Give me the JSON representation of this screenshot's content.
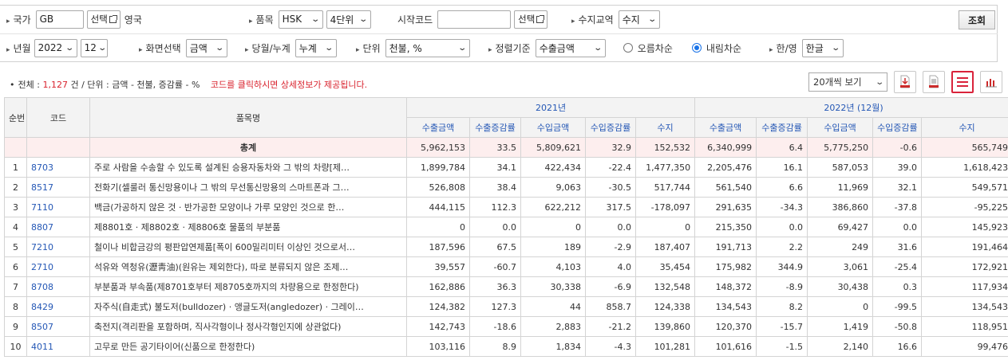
{
  "filters": {
    "country": {
      "label": "국가",
      "value": "GB",
      "select_button": "선택",
      "country_name": "영국"
    },
    "item": {
      "label": "품목",
      "scheme": "HSK",
      "digits": "4단위"
    },
    "start_code": {
      "label": "시작코드",
      "value": "",
      "select_button": "선택"
    },
    "trade_type": {
      "label": "수지교역",
      "value": "수지"
    },
    "search_button": "조회",
    "year_month": {
      "label": "년월",
      "year": "2022",
      "month": "12"
    },
    "screen": {
      "label": "화면선택",
      "value": "금액"
    },
    "period": {
      "label": "당월/누계",
      "value": "누계"
    },
    "unit": {
      "label": "단위",
      "value": "천불, %"
    },
    "sort": {
      "label": "정렬기준",
      "value": "수출금액",
      "asc_label": "오름차순",
      "desc_label": "내림차순",
      "selected": "desc"
    },
    "lang": {
      "label": "한/영",
      "value": "한글"
    }
  },
  "summary": {
    "total_label": "전체 :",
    "count": "1,127",
    "count_suffix": "건 / 단위 : 금액 - 천불, 증감률 - %",
    "notice": "코드를 클릭하시면 상세정보가 제공됩니다."
  },
  "toolbar": {
    "page_size": "20개씩 보기",
    "icons": [
      "download-red-icon",
      "print-doc-icon",
      "list-view-icon",
      "bar-chart-icon"
    ]
  },
  "colors": {
    "accent": "#d9232e",
    "link": "#2457b5",
    "total_row": "#fdeeee",
    "header_bg": "#f3f3f3"
  },
  "table": {
    "headers": {
      "rank": "순번",
      "code": "코드",
      "name": "품목명",
      "year1": "2021년",
      "year2": "2022년 (12월)",
      "cols": [
        "수출금액",
        "수출증감률",
        "수입금액",
        "수입증감률",
        "수지"
      ]
    },
    "total": {
      "label": "총계",
      "y1": [
        "5,962,153",
        "33.5",
        "5,809,621",
        "32.9",
        "152,532"
      ],
      "y2": [
        "6,340,999",
        "6.4",
        "5,775,250",
        "-0.6",
        "565,749"
      ]
    },
    "rows": [
      {
        "rank": "1",
        "code": "8703",
        "name": "주로 사람을 수송할 수 있도록 설계된 승용자동차와 그 밖의 차량[제…",
        "y1": [
          "1,899,784",
          "34.1",
          "422,434",
          "-22.4",
          "1,477,350"
        ],
        "y2": [
          "2,205,476",
          "16.1",
          "587,053",
          "39.0",
          "1,618,423"
        ]
      },
      {
        "rank": "2",
        "code": "8517",
        "name": "전화기(셀룰러 통신망용이나 그 밖의 무선통신망용의 스마트폰과 그…",
        "y1": [
          "526,808",
          "38.4",
          "9,063",
          "-30.5",
          "517,744"
        ],
        "y2": [
          "561,540",
          "6.6",
          "11,969",
          "32.1",
          "549,571"
        ]
      },
      {
        "rank": "3",
        "code": "7110",
        "name": "백금(가공하지 않은 것 · 반가공한 모양이나 가루 모양인 것으로 한…",
        "y1": [
          "444,115",
          "112.3",
          "622,212",
          "317.5",
          "-178,097"
        ],
        "y2": [
          "291,635",
          "-34.3",
          "386,860",
          "-37.8",
          "-95,225"
        ]
      },
      {
        "rank": "4",
        "code": "8807",
        "name": "제8801호 · 제8802호 · 제8806호 물품의 부분품",
        "y1": [
          "0",
          "0.0",
          "0",
          "0.0",
          "0"
        ],
        "y2": [
          "215,350",
          "0.0",
          "69,427",
          "0.0",
          "145,923"
        ]
      },
      {
        "rank": "5",
        "code": "7210",
        "name": "철이나 비합금강의 평판압연제품[폭이 600밀리미터 이상인 것으로서…",
        "y1": [
          "187,596",
          "67.5",
          "189",
          "-2.9",
          "187,407"
        ],
        "y2": [
          "191,713",
          "2.2",
          "249",
          "31.6",
          "191,464"
        ]
      },
      {
        "rank": "6",
        "code": "2710",
        "name": "석유와 역청유(瀝靑油)(원유는 제외한다), 따로 분류되지 않은 조제…",
        "y1": [
          "39,557",
          "-60.7",
          "4,103",
          "4.0",
          "35,454"
        ],
        "y2": [
          "175,982",
          "344.9",
          "3,061",
          "-25.4",
          "172,921"
        ]
      },
      {
        "rank": "7",
        "code": "8708",
        "name": "부분품과 부속품(제8701호부터 제8705호까지의 차량용으로 한정한다)",
        "y1": [
          "162,886",
          "36.3",
          "30,338",
          "-6.9",
          "132,548"
        ],
        "y2": [
          "148,372",
          "-8.9",
          "30,438",
          "0.3",
          "117,934"
        ]
      },
      {
        "rank": "8",
        "code": "8429",
        "name": "자주식(自走式) 불도저(bulldozer) · 앵글도저(angledozer) · 그레이…",
        "y1": [
          "124,382",
          "127.3",
          "44",
          "858.7",
          "124,338"
        ],
        "y2": [
          "134,543",
          "8.2",
          "0",
          "-99.5",
          "134,543"
        ]
      },
      {
        "rank": "9",
        "code": "8507",
        "name": "축전지(격리판을 포함하며, 직사각형이나 정사각형인지에 상관없다)",
        "y1": [
          "142,743",
          "-18.6",
          "2,883",
          "-21.2",
          "139,860"
        ],
        "y2": [
          "120,370",
          "-15.7",
          "1,419",
          "-50.8",
          "118,951"
        ]
      },
      {
        "rank": "10",
        "code": "4011",
        "name": "고무로 만든 공기타이어(신품으로 한정한다)",
        "y1": [
          "103,116",
          "8.9",
          "1,834",
          "-4.3",
          "101,281"
        ],
        "y2": [
          "101,616",
          "-1.5",
          "2,140",
          "16.6",
          "99,476"
        ]
      }
    ]
  }
}
